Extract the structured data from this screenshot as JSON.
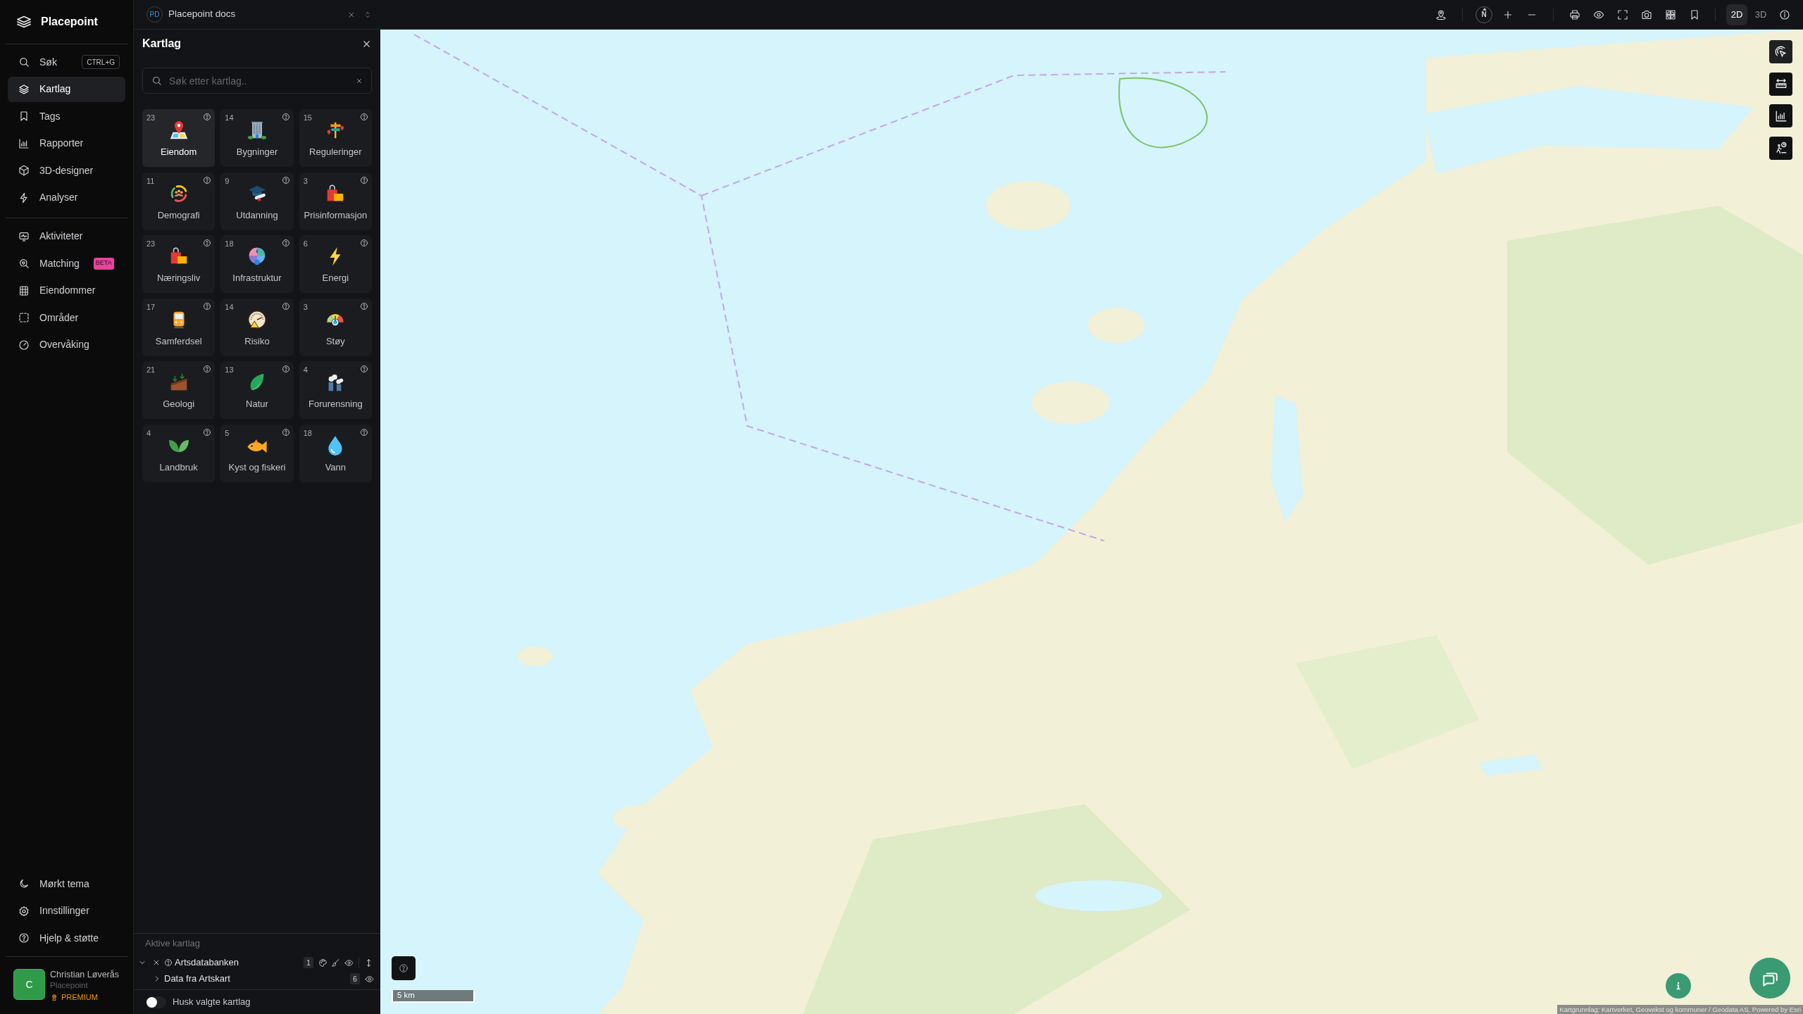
{
  "app": {
    "name": "Placepoint"
  },
  "nav": {
    "main": [
      {
        "label": "Søk",
        "shortcut": "CTRL+G",
        "selected": false
      },
      {
        "label": "Kartlag",
        "selected": true
      },
      {
        "label": "Tags",
        "selected": false
      },
      {
        "label": "Rapporter",
        "selected": false
      },
      {
        "label": "3D-designer",
        "selected": false
      },
      {
        "label": "Analyser",
        "selected": false
      }
    ],
    "modules": [
      {
        "label": "Aktiviteter",
        "selected": false
      },
      {
        "label": "Matching",
        "badge": "BETA",
        "selected": false
      },
      {
        "label": "Eiendommer",
        "selected": false
      },
      {
        "label": "Områder",
        "selected": false
      },
      {
        "label": "Overvåking",
        "selected": false
      }
    ],
    "footer": [
      {
        "label": "Mørkt tema"
      },
      {
        "label": "Innstillinger"
      },
      {
        "label": "Hjelp & støtte"
      }
    ]
  },
  "user": {
    "initial": "C",
    "name": "Christian Løverås",
    "organization": "Placepoint",
    "plan": "PREMIUM"
  },
  "workspace_tab": {
    "initials": "PD",
    "title": "Placepoint docs"
  },
  "layers_panel": {
    "title": "Kartlag",
    "search": {
      "placeholder": "Søk etter kartlag.."
    },
    "categories": [
      {
        "count": "23",
        "label": "Eiendom",
        "selected": true
      },
      {
        "count": "14",
        "label": "Bygninger",
        "selected": false
      },
      {
        "count": "15",
        "label": "Reguleringer",
        "selected": false
      },
      {
        "count": "11",
        "label": "Demografi",
        "selected": false
      },
      {
        "count": "9",
        "label": "Utdanning",
        "selected": false
      },
      {
        "count": "3",
        "label": "Prisinformasjon",
        "selected": false
      },
      {
        "count": "23",
        "label": "Næringsliv",
        "selected": false
      },
      {
        "count": "18",
        "label": "Infrastruktur",
        "selected": false
      },
      {
        "count": "6",
        "label": "Energi",
        "selected": false
      },
      {
        "count": "17",
        "label": "Samferdsel",
        "selected": false
      },
      {
        "count": "14",
        "label": "Risiko",
        "selected": false
      },
      {
        "count": "3",
        "label": "Støy",
        "selected": false
      },
      {
        "count": "21",
        "label": "Geologi",
        "selected": false
      },
      {
        "count": "13",
        "label": "Natur",
        "selected": false
      },
      {
        "count": "4",
        "label": "Forurensning",
        "selected": false
      },
      {
        "count": "4",
        "label": "Landbruk",
        "selected": false
      },
      {
        "count": "5",
        "label": "Kyst og fiskeri",
        "selected": false
      },
      {
        "count": "18",
        "label": "Vann",
        "selected": false
      }
    ],
    "active_layers": {
      "title": "Aktive kartlag",
      "groups": [
        {
          "name": "Artsdatabanken",
          "count": "1",
          "expanded": true,
          "children": [
            {
              "name": "Data fra Artskart",
              "count": "6",
              "expanded": false
            }
          ]
        }
      ]
    },
    "remember_toggle": {
      "label": "Husk valgte kartlag",
      "on": false
    }
  },
  "map_toolbar": {
    "compass": "N",
    "view_modes": [
      {
        "label": "2D",
        "selected": true
      },
      {
        "label": "3D",
        "selected": false
      }
    ]
  },
  "map": {
    "scale": "5 km",
    "attribution": "Kartgrunnlag: Kartverket, Geovekst og kommuner / Geodata AS, Powered by Esri"
  }
}
